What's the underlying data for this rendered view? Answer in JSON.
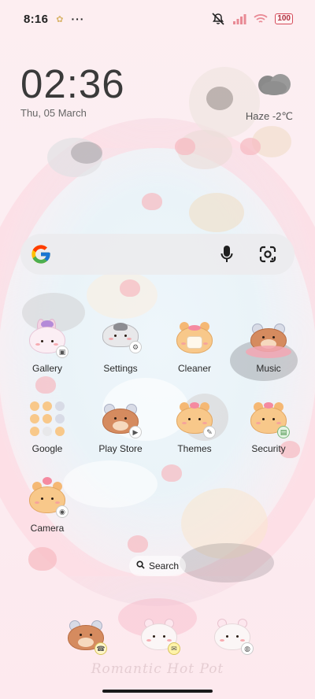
{
  "status_bar": {
    "time": "8:16",
    "more": "···",
    "battery": "100"
  },
  "clock_widget": {
    "time": "02:36",
    "date": "Thu, 05 March",
    "weather": "Haze  -2℃"
  },
  "search_widget": {
    "logo": "google-g-icon",
    "voice_icon": "microphone-icon",
    "lens_icon": "lens-camera-icon"
  },
  "apps": [
    {
      "label": "Gallery",
      "icon": "gallery-icon",
      "character": "bunny"
    },
    {
      "label": "Settings",
      "icon": "settings-icon",
      "character": "grey-cat"
    },
    {
      "label": "Cleaner",
      "icon": "cleaner-icon",
      "character": "tiger-cub"
    },
    {
      "label": "Music",
      "icon": "music-icon",
      "character": "bear-headphones"
    },
    {
      "label": "Google",
      "icon": "google-folder-icon",
      "character": "folder"
    },
    {
      "label": "Play Store",
      "icon": "play-store-icon",
      "character": "bear-headphones"
    },
    {
      "label": "Themes",
      "icon": "themes-icon",
      "character": "tiger-cub"
    },
    {
      "label": "Security",
      "icon": "security-icon",
      "character": "tiger-cub"
    },
    {
      "label": "Camera",
      "icon": "camera-icon",
      "character": "tiger-cub"
    }
  ],
  "search_pill": {
    "label": "Search",
    "icon": "search-icon"
  },
  "dock": [
    {
      "icon": "phone-icon",
      "character": "bear-headphones"
    },
    {
      "icon": "messages-icon",
      "character": "white-cat"
    },
    {
      "icon": "browser-icon",
      "character": "white-cat"
    }
  ],
  "wallpaper_signature": "Romantic Hot Pot",
  "colors": {
    "background": "#fdf0f2",
    "search_bar": "#ececee",
    "battery_border": "#d64a5a",
    "text": "#2a2a2a"
  }
}
